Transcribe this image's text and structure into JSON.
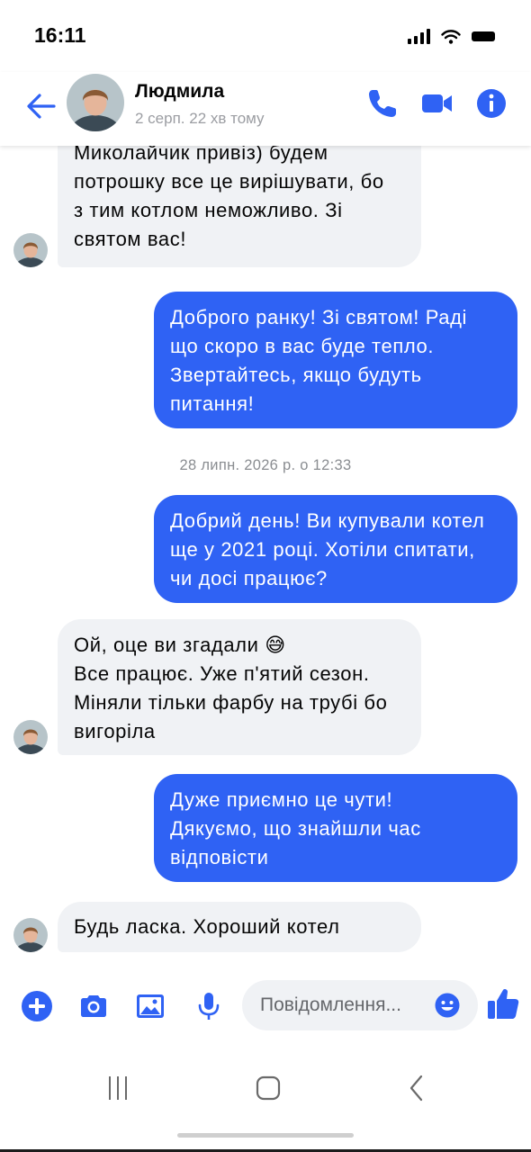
{
  "status_bar": {
    "time": "16:11"
  },
  "header": {
    "contact_name": "Людмила",
    "contact_status": "2 серп. 22 хв тому",
    "icons": [
      "back-arrow-icon",
      "phone-icon",
      "video-camera-icon",
      "info-icon"
    ]
  },
  "conversation": {
    "messages": [
      {
        "direction": "incoming",
        "lines": [
          "Миколайчик привіз) будем",
          "потрошку все це вирішувати, бо",
          "з тим котлом неможливо. Зі",
          "святом вас!"
        ]
      },
      {
        "direction": "outgoing",
        "lines": [
          "Доброго ранку! Зі святом! Раді",
          "що скоро в вас буде тепло.",
          "Звертайтесь, якщо будуть",
          "питання!"
        ]
      },
      {
        "direction": "outgoing",
        "lines": [
          "Добрий день! Ви купували котел",
          "ще у 2021 році. Хотіли спитати,",
          "чи досі працює?"
        ]
      },
      {
        "direction": "incoming",
        "lines": [
          "Ой, оце ви згадали 😅",
          "Все працює. Уже п'ятий сезон.",
          "Міняли тільки фарбу на трубі бо",
          "вигоріла"
        ]
      },
      {
        "direction": "outgoing",
        "lines": [
          "Дуже приємно це чути!",
          "Дякуємо, що знайшли час",
          "відповісти"
        ]
      },
      {
        "direction": "incoming",
        "lines": [
          "Будь ласка. Хороший котел"
        ]
      }
    ],
    "date_divider": "28 липн. 2026 р. о 12:33"
  },
  "composer": {
    "placeholder": "Повідомлення...",
    "icons": [
      "plus-icon",
      "camera-icon",
      "image-icon",
      "microphone-icon",
      "emoji-icon",
      "thumbs-up-icon"
    ]
  },
  "nav_bar": {
    "icons": [
      "recent-apps-icon",
      "home-icon",
      "back-icon"
    ]
  },
  "colors": {
    "accent": "#2f62f4",
    "incoming_bubble": "#f0f2f5",
    "outgoing_bubble": "#2f62f4",
    "secondary_text": "#9b9da2"
  }
}
